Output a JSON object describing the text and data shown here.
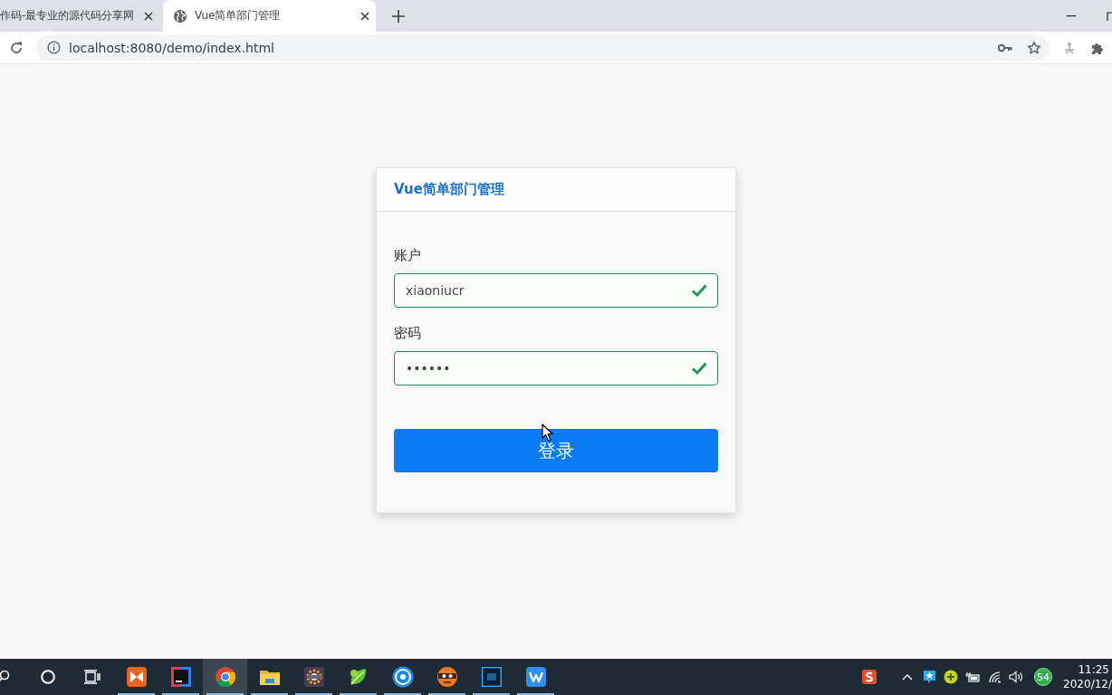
{
  "browser": {
    "tabs": [
      {
        "title": "作码-最专业的源代码分享网",
        "selected": false
      },
      {
        "title": "Vue简单部门管理",
        "selected": true
      }
    ],
    "address": "localhost:8080/demo/index.html"
  },
  "login_card": {
    "title": "Vue简单部门管理",
    "fields": [
      {
        "label": "账户",
        "value": "xiaoniucr",
        "valid": true
      },
      {
        "label": "密码",
        "value": "••••••",
        "valid": true
      }
    ],
    "submit_button": "登录"
  },
  "taskbar": {
    "apps": [
      {
        "running": true,
        "selected": false
      },
      {
        "running": true,
        "selected": false
      },
      {
        "running": true,
        "selected": true
      },
      {
        "running": true,
        "selected": false
      },
      {
        "running": true,
        "selected": false
      },
      {
        "running": true,
        "selected": false
      },
      {
        "running": true,
        "selected": false
      },
      {
        "running": true,
        "selected": false
      },
      {
        "running": true,
        "selected": false
      },
      {
        "running": true,
        "selected": false
      }
    ],
    "tray_badge": "54",
    "time": "11:25",
    "date": "2020/12/"
  }
}
